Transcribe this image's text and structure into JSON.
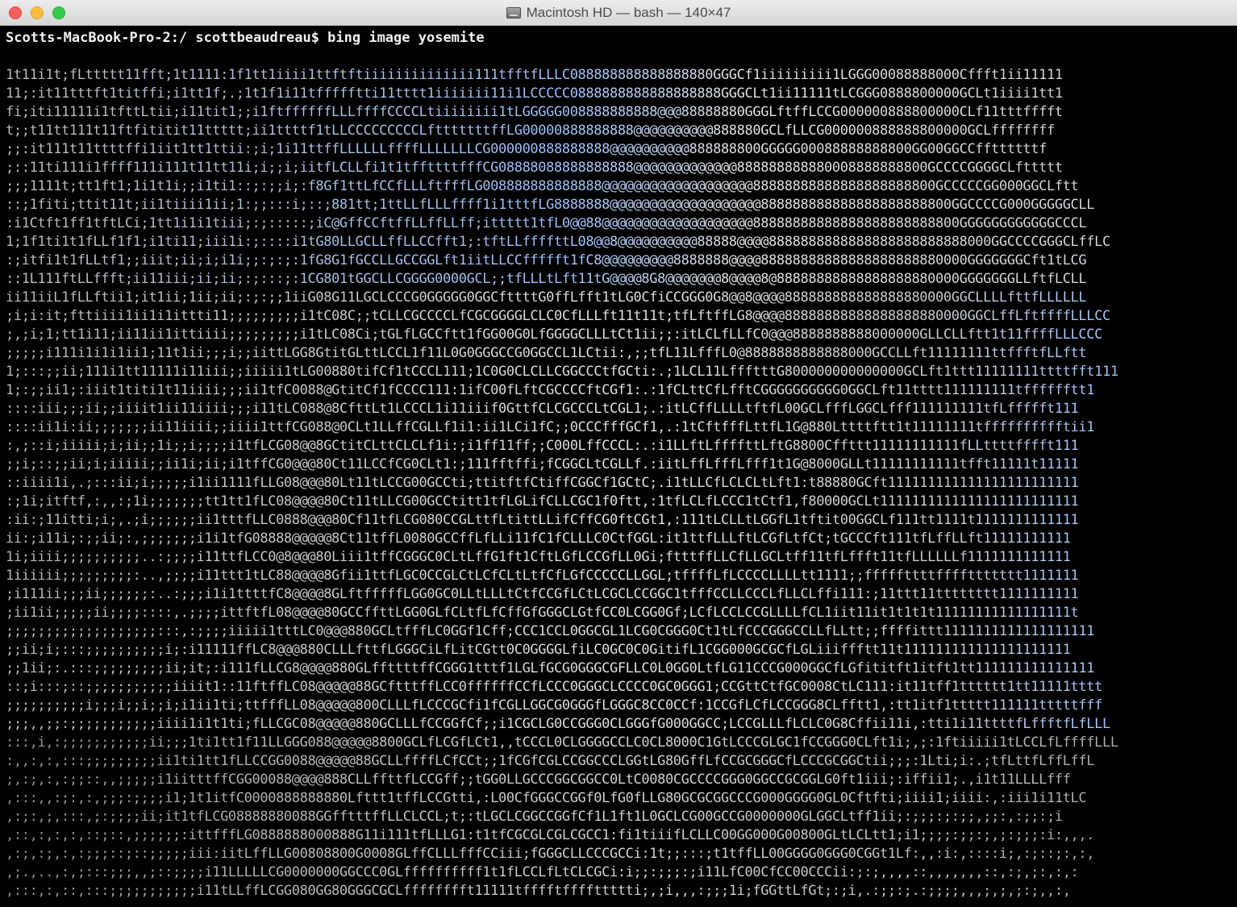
{
  "window": {
    "title": "Macintosh HD — bash — 140×47",
    "title_icon": "hard-disk-icon",
    "buttons": [
      "close",
      "minimize",
      "zoom"
    ]
  },
  "terminal": {
    "prompt": "Scotts-MacBook-Pro-2:/ scottbeaudreau$ bing image yosemite",
    "art_lines": [
      "1t11i1t;fLttttt11fft;1t1111:1f1tt1iiii1ttftftiiiiiiiiiiiiii111tfftfLLLC088888888888888880GGGCf1iiiiiiiii1LGGG00088888000Cffft1ii11111",
      "11;:it11tttft1titffi;i1tt1f;.;1t1f1i11tffffftti11tttt1iiiiiii11i1LCCCCC0888888888888888888GGGCLt1ii11111tLCGGG0888800000GCLt1iiii1tt1",
      "fi;iti11111i1tfttLtii;i11tit1;;i1ftffffffLLLffffCCCCLtiiiiiiii1tLGGGGG008888888888@@@88888880GGGLftffLCCG000000888800000CLf11tttfffft",
      "t;;t11tt111t11ftfititit11ttttt;ii1ttttf1tLLCCCCCCCCCLftttttttffLG00000888888888@@@@@@@@@@888880GCLfLLCG000000888888800000GCLffffffff",
      ";;:it111t11ttttffi1iit1tt1ttii:;i;1i11ttffLLLLLLffffLLLLLLLCG000000888888888@@@@@@@@@@888888800GGGGG00088888888800GG00GGCCffttttttf",
      ";::11ti111i1ffff111i111t11tt11i;i;;i;iitfLCLLfi1t1tffttttfffCG08888088888888888@@@@@@@@@@@@@888888888880008888888800GCCCCGGGGCLfttttt",
      ";;;1111t;tt1ft1;1i1t1i;;i1ti1::;:;;i;:f8Gf1ttLfCCfLLLftfffLG008888888888888@@@@@@@@@@@@@@@@@@@88888888888888888888800GCCCCCGG000GGCLftt",
      "::;1fiti;ttit11t;ii1tiiii1ii;1:;;:::i;::;881tt;1ttLLfLLLffff1i1tttfLG8888888@@@@@@@@@@@@@@@@@@@888888888888888888888800GGCCCCG000GGGGGCLL",
      ":i1Ctft1ff1tftLCi;1tt1i1i1tiii;:;:::::;iC@GffCCftffLLffLLff;ittttt1tfL0@@88@@@@@@@@@@@@@@@@@@@88888888888888888888888800GGGGGGGGGGGGCCCL",
      "1;1f1ti1t1fLLf1f1;i1ti11;iii1i:;::::i1tG80LLGCLLffLLCCfft1;:tftLLffffttL08@@8@@@@@@@@@@88888@@@@8888888888888888888888888000GGCCCCGGGCLffLC",
      ":;itfi1t1fLLtf1;;iiit;ii;i;i1i;;:;:;:1fG8G1fGCCLLGCCGGLft1iitLLCCffffft1fC8@@@@@@@@@8888888@@@@88888888888888888888880000GGGGGGGCft1tLCG",
      "::1L111ftLLffft;ii11iii;ii;ii;:;:::;:1CG801tGGCLLCGGGG0000GCL;;tfLLLtLft11tG@@@@8G8@@@@@@@8@@@@8@88888888888888888880000GGGGGGGLLftfLCLL",
      "ii11iiL1fLLftii1;it1ii;1ii;ii;:;:;;1iiG08G11LGCLCCCG0GGGGG0GGCfttttG0ffLfft1tLG0CfiCCGGG0G8@@8@@@@888888888888888880000GGCLLLLfttfLLLLLL",
      ";i;i:it;fttiiii1ii1i1ittti11;;;;;;;;;i1tC08C;;tCLLCGCCCCLfCGCGGGGLCLC0CfLLLft11t11t;tfLftffLG8@@@@88888888888888888880000GGCLffLftffffLLLCC",
      ";,;i;1;tt1i11;ii11ii1ittiiii;;;;;;;;;i1tLC08Ci;tGLfLGCCftt1fGG00G0LfGGGGCLLLtCt1ii;;:itLCLfLLfC0@@@8888888888000000GLLCLLftt1t11ffffLLLCCC",
      ";;;;;i111i1i1i1ii1;11t1ii;;;i;;iittLGG8GtitGLttLCCL1f11L0G0GGGCCG0GGCCL1LCtii:,;;tfL11LfffL0@8888888888888000GCCLLft11111111ttffftfLLftt",
      "1;:::;;ii;111i1tt11111i11iii;;iiiii1tLG00880tifCf1tCCCL111;1C0G0CLCLLCGGCCCtfGCti:.;1LCL11LffftttG800000000000000GCLft1ttt11111111ttttfft111",
      "1;:;;ii1;:iiit1titi1t11iiii;;;ii1tfC0088@GtitCf1fCCCC111:1ifC00fLftCGCCCCftCGf1:.:1fCLttCfLfftCGGGGGGGGGG0GGCLft11tttt111111111tfffffftt1",
      "::::iii;;;ii;;iiiit1ii11iiii;;;i11tLC088@8CfttLt1LCCCL1i11iiif0GttfCLCGCCCLtCGL1;.:itLCffLLLLtftfL00GCLfffLGGCLfff111111111tfLffffft111",
      "::::ii1i:ii;;;;;;;ii11iiii;;iiii1ttfCG088@0CLt1LLffCGLLf1i1:ii1LCi1fC;;0CCCfffGCf1,.:1tCftfffLttfL1G@880Lttttftt1t11111111tfffffffffftii1",
      ":,;::i;iiiii;i;ii;;1i;;i;;;;i1tfLCG08@@8GCtitCLttCLCLf1i:;i1ff11ff;;C000LffCCCL:.:i1LLftLffffttLftG8800Cffttt11111111111fLLttttfffft111",
      ";;i;::;;ii;i;iiiii;;ii1i;ii;i1tffCG0@@@80Ct11LCCfCG0CLt1:;111fftffi;fCGGCLtCGLLf.:iitLffLfffLfff1t1G@8000GLLt11111111111tfft11111t11111",
      "::iiii1i,.;:::ii;i;;;;;i1ii1111fLLG08@@@80Lt11tLCCG00GCCti;ttitftfCtiffCGGCf1GCtC;.i1tLLCfLCLCLtLft1:t88880GCft111111111111111111111111",
      ":;1i;itftf,:,,:;1i;;;;;;;tt1tt1fLC08@@@@80Ct11tLLCG00GCCtitt1tfLGLifCLLCGC1f0ftt,:1tfLCLfLCCC1tCtf1,f80000GCLt1111111111111111111111111",
      ":ii:;11itti;i;,.;i;;;;;;ii1tttfLLC0888@@@80Cf11tfLCG080CCGLttfLtittLLifCffCG0ftCGt1,:111tLCLLtLGGfL1tftit00GGCLf111tt1111t1111111111111",
      "ii:;i11i;:;;ii;:,;;;;;;;i1i1tfG08888@@@@@8Ct11tffL0080GCCffLfLLi11fC1fCLLLC0CtfGGL:it1ttfLLLftLCGfLtfCt;tGCCCft111tfLffLLft11111111111",
      "1i;iiii;;;;;;;;;;..:;;;;i11ttfLCC0@8@@@80Liii1tffCGGGC0CLtLffG1ft1CftLGfLCCGfLL0Gi;ftttffLLCfLLGCLtff11tfLffft11tfLLLLLLf1111111111111",
      "1iiiiii;;;;;;;;;:..,;;;;i11ttt1tLC88@@@@8Gfii1ttfLGC0CCGLCtLCfCLtLtfCfLGfCCCCCLLGGL;tffffLfLCCCCLLLLtt1111;;fffffttttffffttttttt1111111",
      ";i111ii;;;ii;;;;;;:..:;;;i1i1ttttfC8@@@@8GLftfffffLGG0GC0LLtLLLtCtfCCGfLCtLCGCLCCGGC1tfffCCLLCCCLfLLCLffi111:;11ttt11tttttttt1111111111",
      ";ii1ii;;;;;ii;;;;::::,.;;;;ittftfL08@@@@80GCCffttLGG0GLfCLtfLfCffGfGGGCLGtfCC0LCGG0Gf;LCfLCCLCCGLLLLfCL1iit11it1t1t1t11111111111111111t",
      ";;;;;;;;;;;;;;;;;;;:::,:;;;;iiiii1tttLC0@@@880GCLtfffLC0GGf1Cff;CCC1CCL0GGCGL1LCG0CGGG0Ct1tLfCCCGGGCCLLfLLtt;;ffffittt1111111111111111111",
      ";;ii;i;:::;;;;;;;;;;i;:i11111ffLC8@@@880CLLLfttfLGGGCiLfLitCGtt0C0GGGGLfiLC0GC0C0GitifL1CGG000GCGCfLGLiiiffftt11t111111111111111111111",
      ";;1ii;:.:::;;;;;;;;;ii;it;:i111fLLCG8@@@@880GLffttttffCGGG1tttf1LGLfGCG0GGGCGFLLC0L0GG0LtfLG11CCCG000GGCfLGfititft1itft1tt111111111111111",
      "::;i:::;::;;;;;;;;;;;iiiit1::11ftffLC08@@@@@88GCftttffLCC0ffffffCCfLCCC0GGGCLCCCC0GC0GGG1;CCGttCtfGC0008CtLC111:it11tff1tttttt1tt11111tttt",
      ";;;;;;;;;;i;;;i;;i;;i;i1ii1ti;ttfffLL08@@@@@800CLLLfLCCCGCfi1fCGLLGGCG0GGGfLGGGC8CC0CCf:1CCGfLCfLCCGGG8CLfftt1,:tt1itf1ttttt111111tttttfff",
      ";;;,,;;:;;;;;;;;;;;iiii1i1t1ti;fLLCGC08@@@@@880GCLLLfCCGGfCf;;i1CGCLG0CCGGG0CLGGGfG000GGCC;LCCGLLLfLCLC0G8Cffii11i,:tti1i11ttttfLffftfLfLLL",
      ":::,i,:;;;;;;;;;;;ii;;;1ti1tt1f11LLGGG088@@@@@8800GCLfLCGfLCt1,,tCCCL0CLGGGGCCLC0CL8000C1GtLCCCGLGC1fCCGGG0CLft1i;,;:1ftiiiii1tLCCLfLffffLLL",
      ":,,:,:,:::;;;;;;;;;ii1ti1tt1fLLCCGG0088@@@@@88GCLLffffLCfCCt;;1fCGfCGLCCGGCCCLGGtLG80GffLfCCGCGGGCfLCCCGCGGCtii;;;:1Lti;i:.;tfLttfLffLffL",
      ";,:;,:,:;;::,,;;;;;i1iitttffCGG00088@@@@888CLLffttfLCCGff;;tGG0LLGCCCGGCGGCC0LtC0080CGCCCCGGG0GGCCGCGGLG0ft1iii;:iffii1;.,i1t11LLLLfff",
      ",:::,,:;:,:,;;;:;;;;i1;1t1itfC0000888888880Lfttt1tffLCCGtti,:L00CfGGGCCGGf0LfG0fLLG80GCGCGGCCCG000GGGG0GL0Cftfti;iiii1;iiii:,:iii1i11tLC",
      ",:;:,;,:::,;:;;;;ii;it1tfLCG08888880088GGfftttffLLCLCCL;t;:tLGCLCGGCCGGfCf1L1ft1L0GCLCG00GCCG0000000GLGGCLtff1ii;:;;;:;:;;,;;:,:;;:;i",
      ",::,:,:,:,::;::,;;;;;;:ittfffLG0888888000888G11i111tfLLLG1:t1tfCGCGLCGLCGCC1:fi1tiiifLCLLC00GG000G00800GLtLCLtt1;i1;;;;:;;:;,;:;;;:i:,,,.",
      ",:;,:;,:,:;;;::;::;;;;;iii:iitLffLLG00808800G0008GLffCLLLfffCCiii;fGGGCLLCCCGCCi:1t;;:::;t1tffLL00GGGG0GGG0CGGt1Lf:,,:i:,::::i;,:;::;:,:,",
      ",;.,..,:,;:::;;;,,;::;;;;i11LLLLLCG0000000GGCCC0GLffffffffff1t1fLCCLfLtCLCGCi:i;;:;;;:;i11LfC00CfCC00CCCii:;:;,,,,::,,,,,,,::,:;,;:,:,:",
      ",:::,:,::,:::;;;;;;;;;;;i11tLLffLCGG080GG80GGGCGCLfffffffft11111tfffftffffttttti;,;i,,,:;;;1i;fGGttLfGt;:;i,.:;;:;.:;;;;,,,;,;,;:;,,:,"
    ]
  }
}
